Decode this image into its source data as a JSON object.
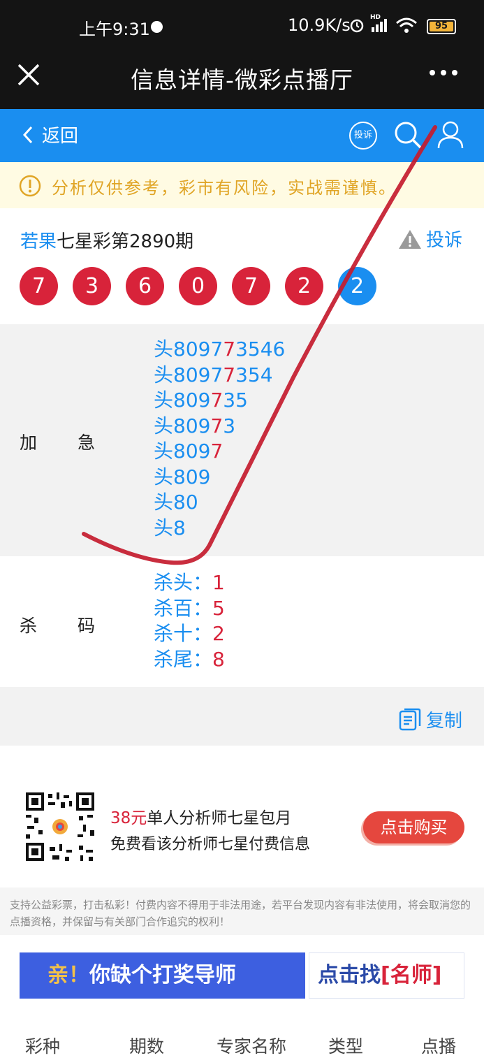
{
  "status_bar": {
    "time": "上午9:31",
    "speed": "10.9K/s",
    "network": "HD",
    "battery": "95"
  },
  "title_bar": {
    "title": "信息详情-微彩点播厅"
  },
  "nav": {
    "back_label": "返回",
    "report_label": "投诉"
  },
  "notice": {
    "text": "分析仅供参考，彩市有风险，实战需谨慎。"
  },
  "header": {
    "author": "若果",
    "issue": "七星彩第2890期",
    "report_label": "投诉"
  },
  "balls": [
    {
      "number": "7",
      "color": "#d8233a"
    },
    {
      "number": "3",
      "color": "#d8233a"
    },
    {
      "number": "6",
      "color": "#d8233a"
    },
    {
      "number": "0",
      "color": "#d8233a"
    },
    {
      "number": "7",
      "color": "#d8233a"
    },
    {
      "number": "2",
      "color": "#d8233a"
    },
    {
      "number": "2",
      "color": "#1a8ef0"
    }
  ],
  "jiaji": {
    "label": "加急",
    "lines": [
      {
        "pre": "头8097",
        "hit": "7",
        "post": "3546"
      },
      {
        "pre": "头8097",
        "hit": "7",
        "post": "354"
      },
      {
        "pre": "头809",
        "hit": "7",
        "post": "35"
      },
      {
        "pre": "头809",
        "hit": "7",
        "post": "3"
      },
      {
        "pre": "头809",
        "hit": "7",
        "post": ""
      },
      {
        "pre": "头809",
        "hit": "",
        "post": ""
      },
      {
        "pre": "头80",
        "hit": "",
        "post": ""
      },
      {
        "pre": "头8",
        "hit": "",
        "post": ""
      }
    ]
  },
  "shama": {
    "label": "杀码",
    "lines": [
      {
        "key": "杀头：",
        "val": "1"
      },
      {
        "key": "杀百：",
        "val": "5"
      },
      {
        "key": "杀十：",
        "val": "2"
      },
      {
        "key": "杀尾：",
        "val": "8"
      }
    ]
  },
  "copy": {
    "label": "复制"
  },
  "promo": {
    "price": "38元",
    "title": "单人分析师七星包月",
    "subtitle": "免费看该分析师七星付费信息",
    "buy_label": "点击购买"
  },
  "disclaimer": "支持公益彩票，打击私彩！付费内容不得用于非法用途，若平台发现内容有非法使用，将会取消您的点播资格，并保留与有关部门合作追究的权利！",
  "banner": {
    "left_prefix": "亲！",
    "left_text": "你缺个打奖导师",
    "right_text": "点击找",
    "right_highlight": "[名师]"
  },
  "table_headers": [
    "彩种",
    "期数",
    "专家名称",
    "类型",
    "点播"
  ],
  "colors": {
    "accent": "#1a8ef0",
    "red": "#d8233a",
    "dark": "#141414",
    "notice": "#e0a526"
  }
}
